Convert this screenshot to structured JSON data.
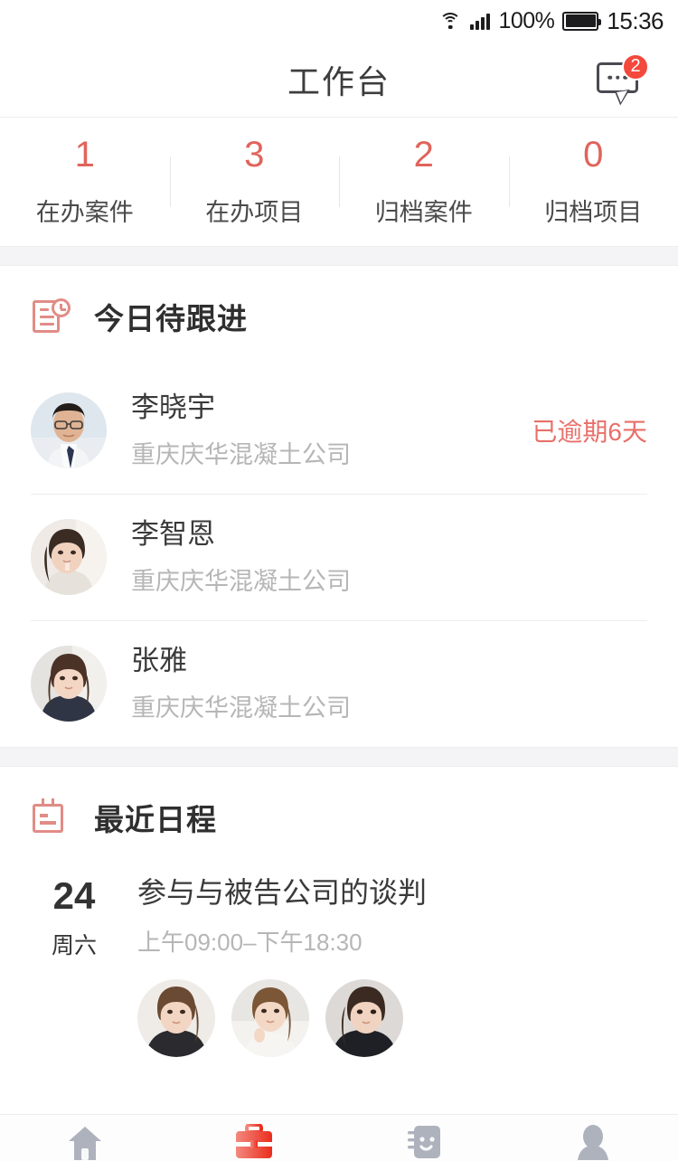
{
  "status_bar": {
    "wifi_icon": "wifi-icon",
    "signal_icon": "signal-bars-icon",
    "battery_percent": "100%",
    "battery_icon": "battery-full-icon",
    "time": "15:36"
  },
  "navbar": {
    "title": "工作台",
    "message_icon": "message-bubble-icon",
    "badge_count": "2"
  },
  "stats": [
    {
      "value": "1",
      "label": "在办案件"
    },
    {
      "value": "3",
      "label": "在办项目"
    },
    {
      "value": "2",
      "label": "归档案件"
    },
    {
      "value": "0",
      "label": "归档项目"
    }
  ],
  "follow_up_section": {
    "icon": "document-clock-icon",
    "title": "今日待跟进",
    "contacts": [
      {
        "name": "李晓宇",
        "org": "重庆庆华混凝土公司",
        "status": "已逾期6天",
        "avatar": "avatar-man-glasses"
      },
      {
        "name": "李智恩",
        "org": "重庆庆华混凝土公司",
        "status": "",
        "avatar": "avatar-woman-1"
      },
      {
        "name": "张雅",
        "org": "重庆庆华混凝土公司",
        "status": "",
        "avatar": "avatar-woman-2"
      }
    ]
  },
  "schedule_section": {
    "icon": "calendar-icon",
    "title": "最近日程",
    "event": {
      "day": "24",
      "weekday": "周六",
      "title": "参与与被告公司的谈判",
      "time": "上午09:00–下午18:30",
      "participants": [
        "avatar-p1",
        "avatar-p2",
        "avatar-p3"
      ]
    }
  },
  "tabbar": {
    "items": [
      {
        "icon": "home-icon",
        "active": false
      },
      {
        "icon": "briefcase-icon",
        "active": true
      },
      {
        "icon": "contacts-icon",
        "active": false
      },
      {
        "icon": "profile-icon",
        "active": false
      }
    ]
  },
  "colors": {
    "accent_red": "#e0645c",
    "badge_red": "#f4483c",
    "icon_rose": "#e18c86",
    "tab_active": "#ea3323",
    "tab_inactive": "#aeb2bd",
    "text_primary": "#3a3a3a",
    "text_muted": "#b6b6b6",
    "band_gray": "#f4f4f6"
  }
}
